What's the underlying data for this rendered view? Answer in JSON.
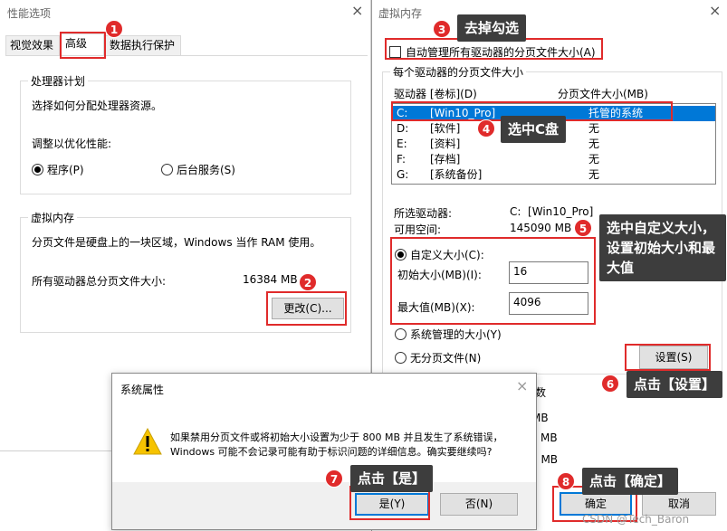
{
  "left_window": {
    "title": "性能选项",
    "close": "×",
    "tabs": [
      "视觉效果",
      "高级",
      "数据执行保护"
    ],
    "processor_group": {
      "title": "处理器计划",
      "desc": "选择如何分配处理器资源。",
      "adjust_label": "调整以优化性能:",
      "option_programs": "程序(P)",
      "option_services": "后台服务(S)"
    },
    "vm_group": {
      "title": "虚拟内存",
      "desc": "分页文件是硬盘上的一块区域，Windows 当作 RAM 使用。",
      "total_label": "所有驱动器总分页文件大小:",
      "total_value": "16384 MB",
      "change_button": "更改(C)..."
    }
  },
  "right_window": {
    "title": "虚拟内存",
    "close": "×",
    "auto_manage": "自动管理所有驱动器的分页文件大小(A)",
    "per_drive_group": "每个驱动器的分页文件大小",
    "col_drive": "驱动器 [卷标](D)",
    "col_size": "分页文件大小(MB)",
    "drives": [
      {
        "letter": "C:",
        "label": "[Win10_Pro]",
        "size": "托管的系统",
        "selected": true
      },
      {
        "letter": "D:",
        "label": "[软件]",
        "size": "无",
        "selected": false
      },
      {
        "letter": "E:",
        "label": "[资料]",
        "size": "无",
        "selected": false
      },
      {
        "letter": "F:",
        "label": "[存档]",
        "size": "无",
        "selected": false
      },
      {
        "letter": "G:",
        "label": "[系统备份]",
        "size": "无",
        "selected": false
      }
    ],
    "selected_drive_label": "所选驱动器:",
    "selected_drive_value": "C:  [Win10_Pro]",
    "free_space_label": "可用空间:",
    "free_space_value": "145090 MB",
    "custom_size": "自定义大小(C):",
    "initial_label": "初始大小(MB)(I):",
    "initial_value": "16",
    "max_label": "最大值(MB)(X):",
    "max_value": "4096",
    "system_managed": "系统管理的大小(Y)",
    "no_paging": "无分页文件(N)",
    "set_button": "设置(S)",
    "partial_label": "数",
    "partial_mb": [
      "MB",
      "MB",
      "4 MB"
    ],
    "ok_button": "确定",
    "cancel_button": "取消"
  },
  "dialog": {
    "title": "系统属性",
    "close": "×",
    "message_line1": "如果禁用分页文件或将初始大小设置为少于 800 MB 并且发生了系统错误，",
    "message_line2": "Windows 可能不会记录可能有助于标识问题的详细信息。确实要继续吗?",
    "yes_button": "是(Y)",
    "no_button": "否(N)"
  },
  "annotations": [
    {
      "num": "1"
    },
    {
      "num": "2"
    },
    {
      "num": "3",
      "text": "去掉勾选"
    },
    {
      "num": "4",
      "text": "选中C盘"
    },
    {
      "num": "5",
      "text": "选中自定义大小，设置初始大小和最大值"
    },
    {
      "num": "6",
      "text": "点击【设置】"
    },
    {
      "num": "7",
      "text": "点击【是】"
    },
    {
      "num": "8",
      "text": "点击【确定】"
    }
  ],
  "watermark": "CSDN @Tech_Baron",
  "colors": {
    "accent": "#0078d7",
    "annotation_red": "#e02b2b",
    "tooltip_bg": "#3d3d3d",
    "selection": "#0078d7"
  }
}
